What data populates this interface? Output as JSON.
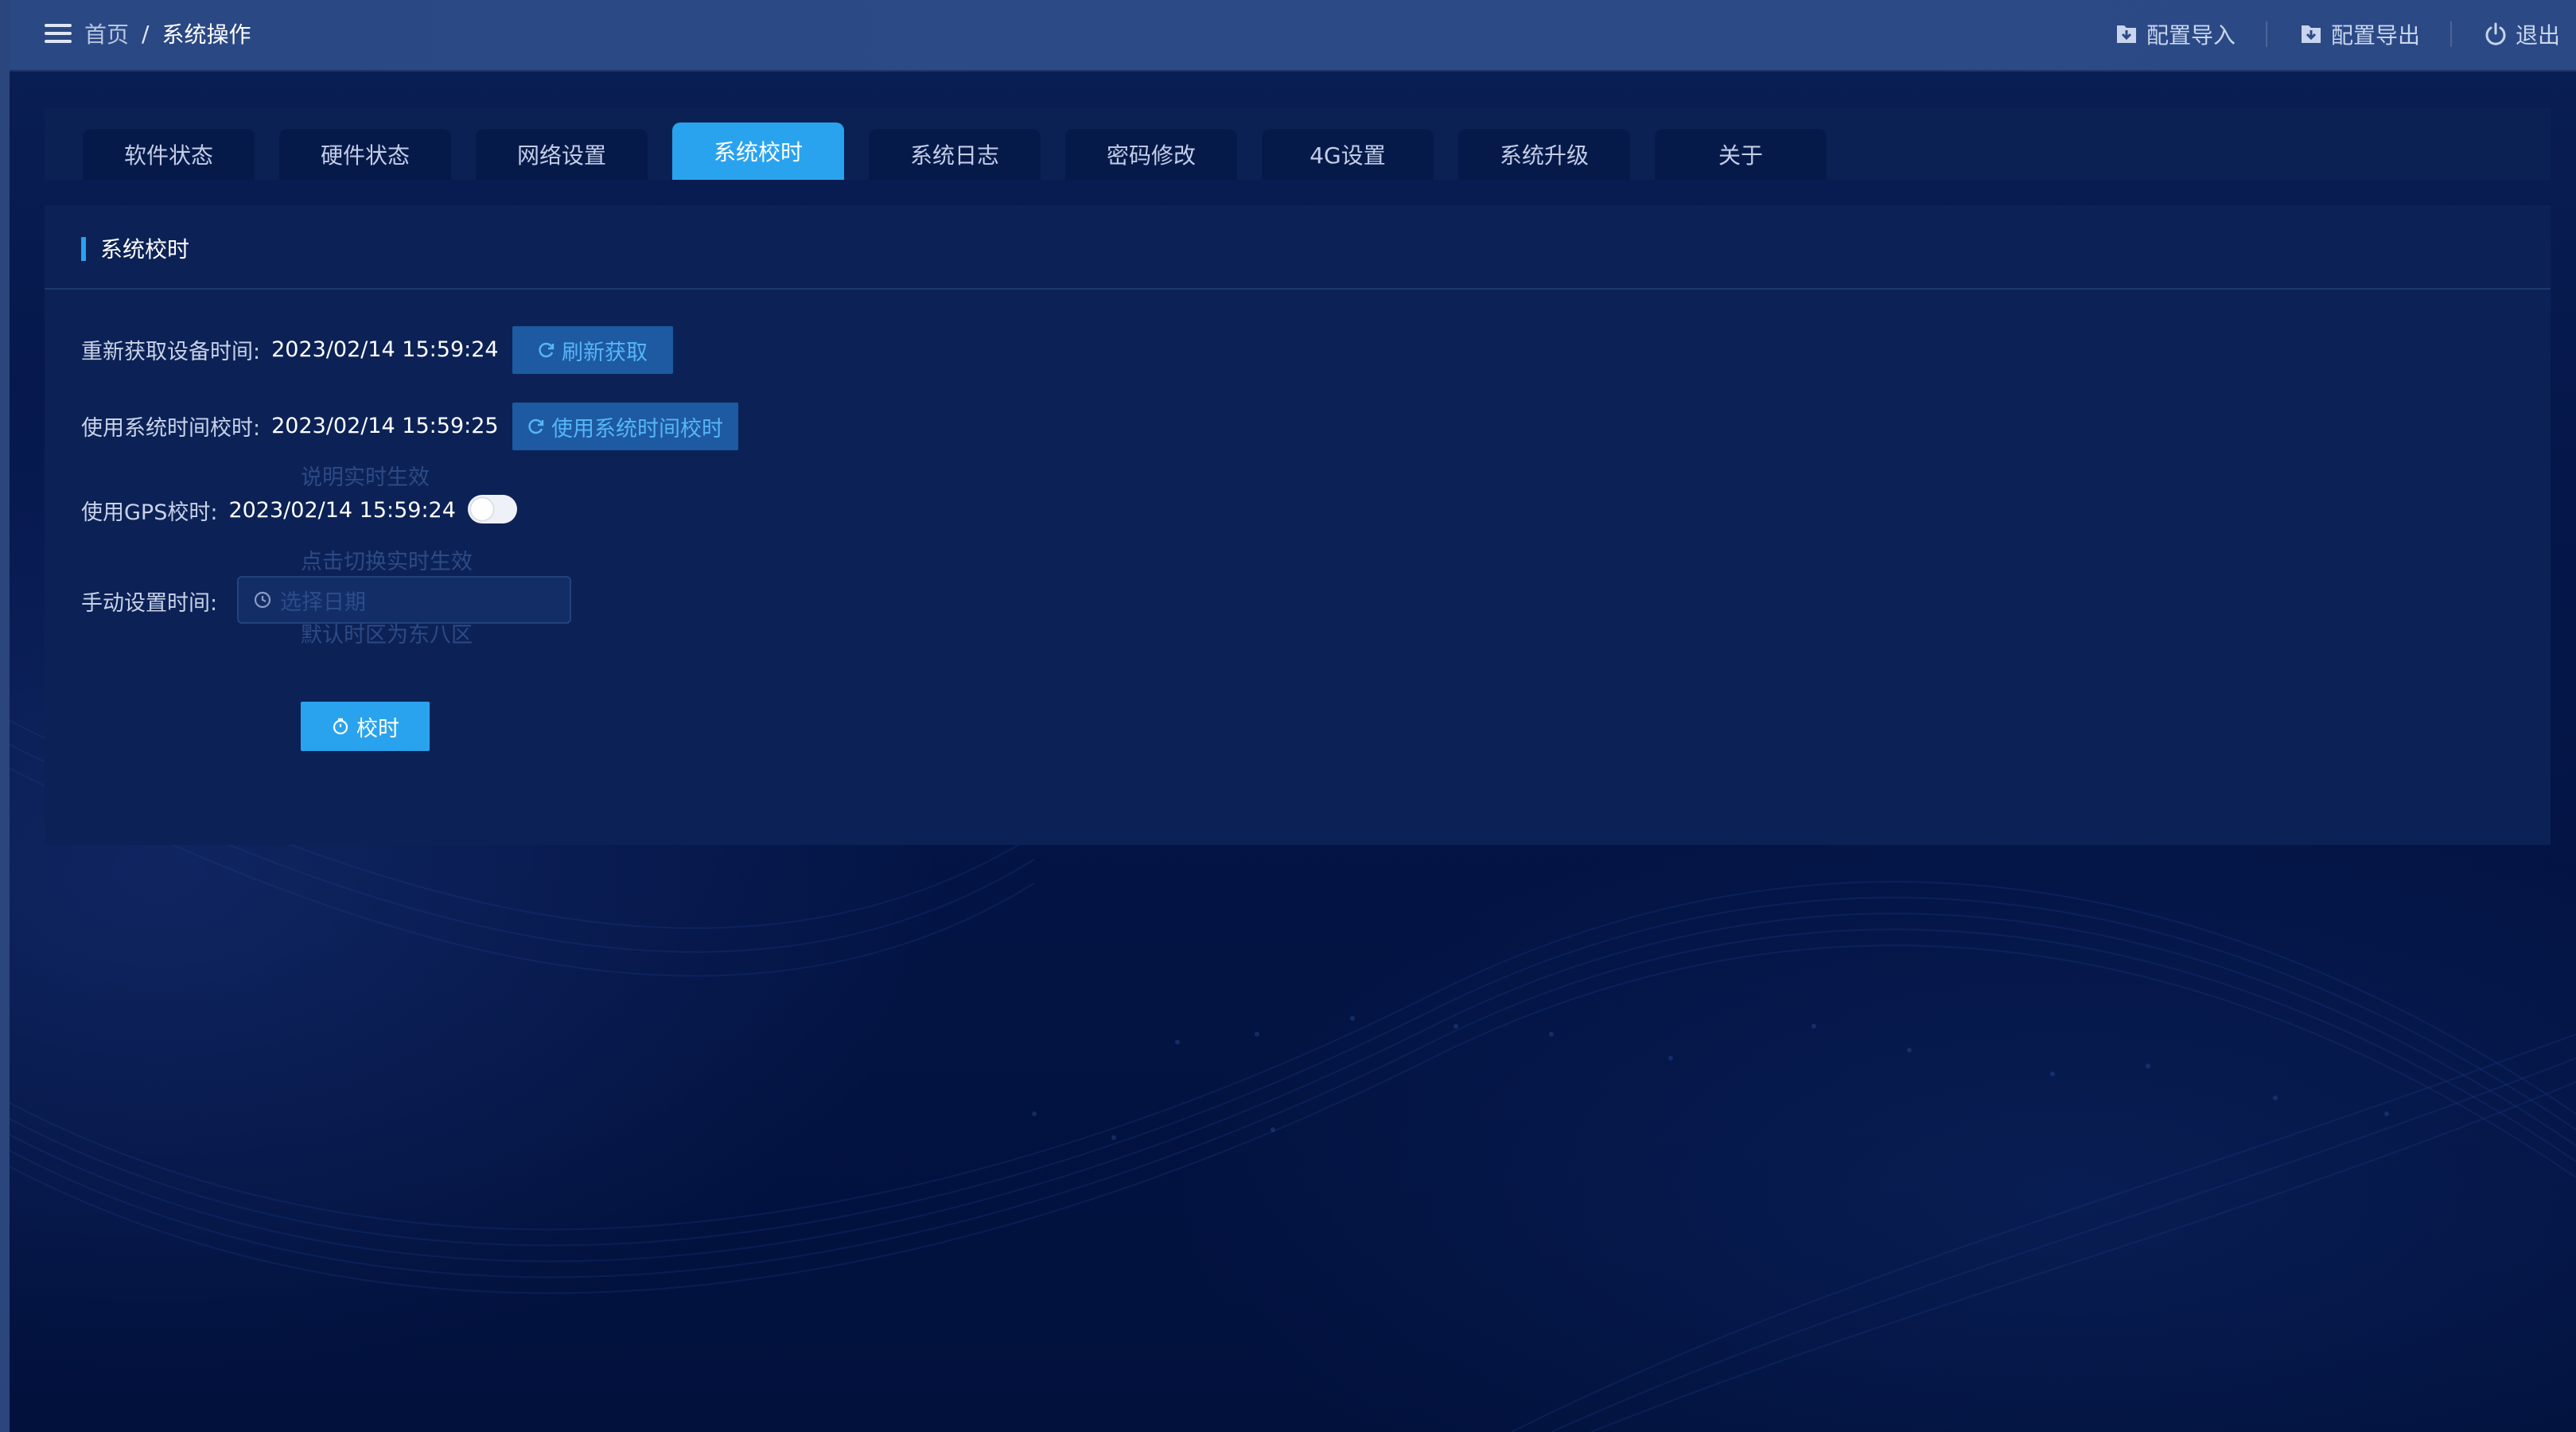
{
  "header": {
    "breadcrumb": {
      "home": "首页",
      "separator": "/",
      "current": "系统操作"
    },
    "actions": [
      {
        "label": "配置导入",
        "icon": "import-icon"
      },
      {
        "label": "配置导出",
        "icon": "export-icon"
      },
      {
        "label": "退出",
        "icon": "power-icon"
      }
    ]
  },
  "tabs": [
    {
      "label": "软件状态"
    },
    {
      "label": "硬件状态"
    },
    {
      "label": "网络设置"
    },
    {
      "label": "系统校时",
      "active": true
    },
    {
      "label": "系统日志"
    },
    {
      "label": "密码修改"
    },
    {
      "label": "4G设置"
    },
    {
      "label": "系统升级"
    },
    {
      "label": "关于"
    }
  ],
  "panel": {
    "title": "系统校时",
    "refresh": {
      "label": "重新获取设备时间:",
      "value": "2023/02/14 15:59:24",
      "button": "刷新获取"
    },
    "system_time": {
      "label": "使用系统时间校时:",
      "value": "2023/02/14 15:59:25",
      "button": "使用系统时间校时"
    },
    "gps": {
      "hint": "说明实时生效",
      "label": "使用GPS校时:",
      "value": "2023/02/14 15:59:24",
      "enabled": false
    },
    "manual": {
      "hint_top": "点击切换实时生效",
      "label": "手动设置时间:",
      "placeholder": "选择日期",
      "hint_bottom": "默认时区为东八区"
    },
    "submit_button": "校时"
  },
  "colors": {
    "accent": "#2aa3ee",
    "header_bg": "#2c4a86",
    "page_bg": "#031440",
    "panel_bg": "#0c2256",
    "secondary_button_bg": "#1d5aa2"
  }
}
